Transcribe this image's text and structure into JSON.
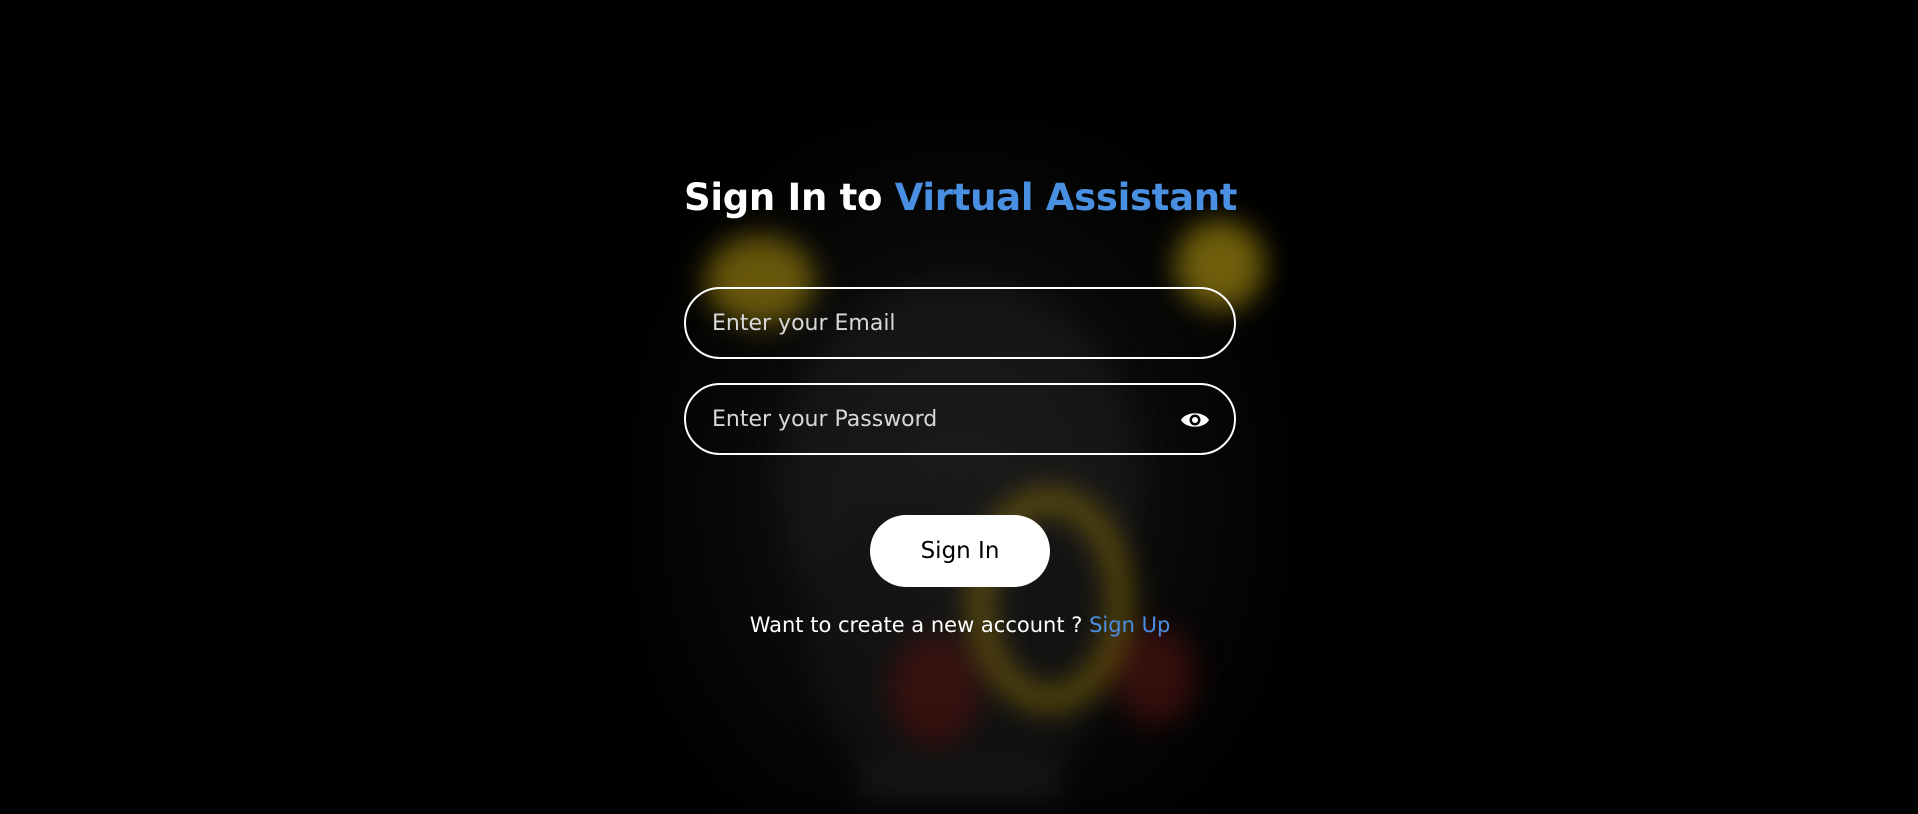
{
  "title": {
    "prefix": "Sign In to ",
    "accent": "Virtual Assistant"
  },
  "email": {
    "placeholder": "Enter your Email",
    "value": ""
  },
  "password": {
    "placeholder": "Enter your Password",
    "value": "",
    "toggle_icon": "eye-icon"
  },
  "signin": {
    "label": "Sign In"
  },
  "footer": {
    "prompt": "Want to create a new account ? ",
    "link": "Sign Up"
  },
  "colors": {
    "background": "#000000",
    "accent": "#4a90e2",
    "text": "#ffffff"
  }
}
